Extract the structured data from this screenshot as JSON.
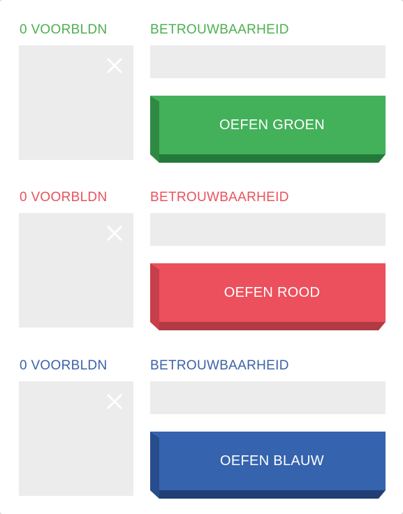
{
  "sections": [
    {
      "count_label": "0 VOORBLDN",
      "reliability_label": "BETROUWBAARHEID",
      "reliability_value": 0,
      "button_label": "OEFEN GROEN",
      "color": "#4caf50",
      "button_color": "#43b05a",
      "button_side": "#2e8a43",
      "button_bottom": "#23793a",
      "close_icon": "close-icon"
    },
    {
      "count_label": "0 VOORBLDN",
      "reliability_label": "BETROUWBAARHEID",
      "reliability_value": 0,
      "button_label": "OEFEN ROOD",
      "color": "#e8525c",
      "button_color": "#eb505c",
      "button_side": "#c73f4a",
      "button_bottom": "#b13a44",
      "close_icon": "close-icon"
    },
    {
      "count_label": "0 VOORBLDN",
      "reliability_label": "BETROUWBAARHEID",
      "reliability_value": 0,
      "button_label": "OEFEN BLAUW",
      "color": "#3b62a8",
      "button_color": "#3563ae",
      "button_side": "#284d8c",
      "button_bottom": "#213f75",
      "close_icon": "close-icon"
    }
  ]
}
